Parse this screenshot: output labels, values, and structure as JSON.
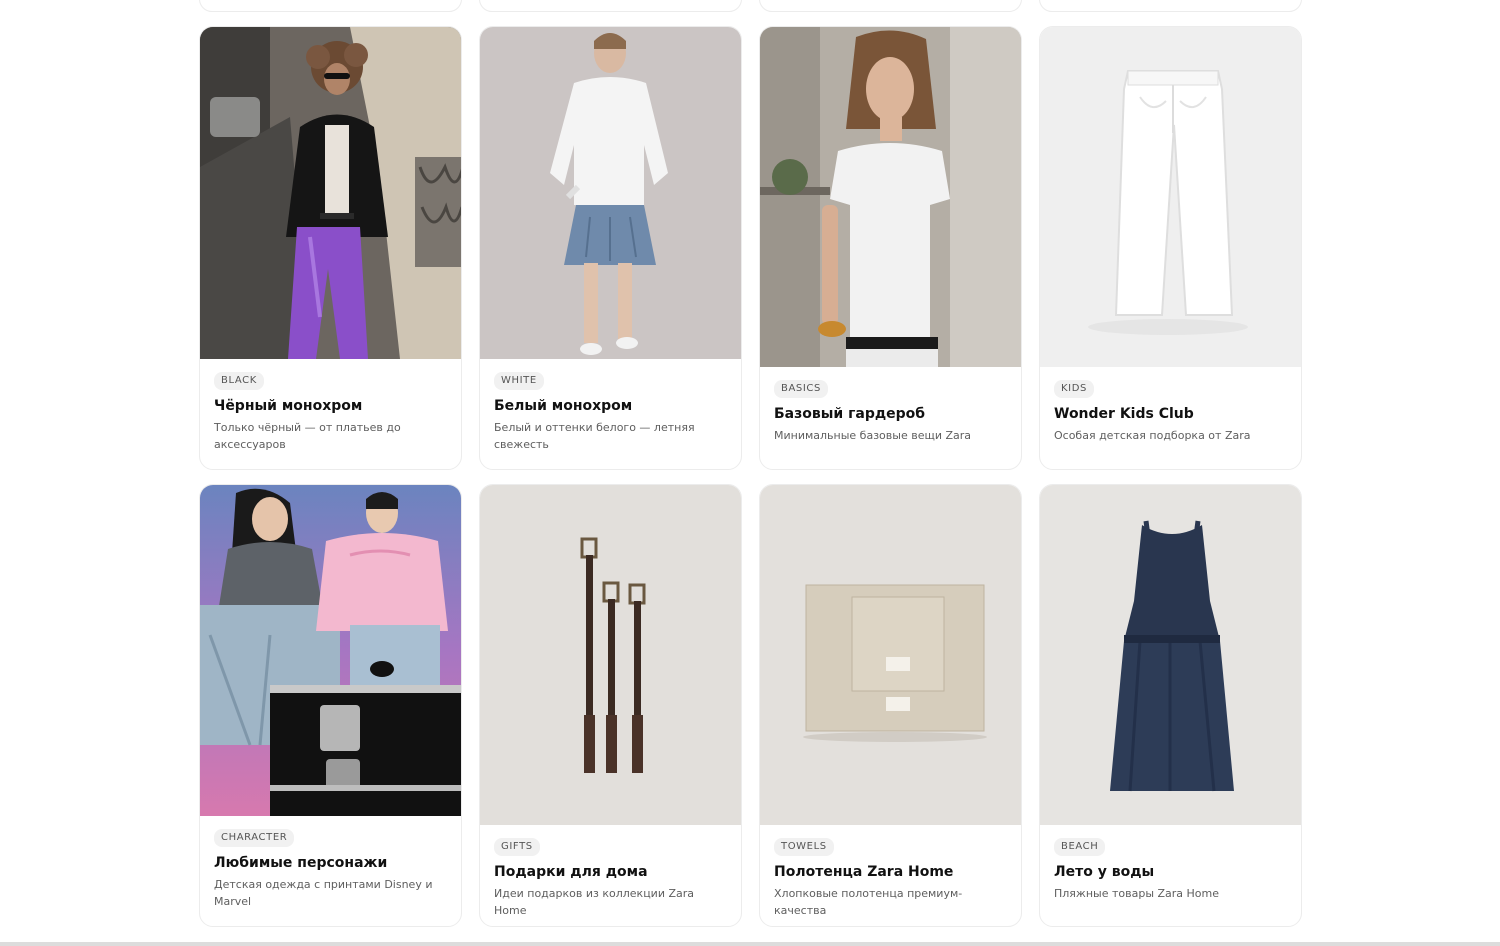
{
  "cards": [
    {
      "tag": "BLACK",
      "title": "Чёрный монохром",
      "desc": "Только чёрный — от платьев до аксессуаров",
      "image": "black-monochrome-photo"
    },
    {
      "tag": "WHITE",
      "title": "Белый монохром",
      "desc": "Белый и оттенки белого — летняя свежесть",
      "image": "white-monochrome-photo"
    },
    {
      "tag": "BASICS",
      "title": "Базовый гардероб",
      "desc": "Минимальные базовые вещи Zara",
      "image": "basics-photo"
    },
    {
      "tag": "KIDS",
      "title": "Wonder Kids Club",
      "desc": "Особая детская подборка от Zara",
      "image": "white-jeans-photo"
    },
    {
      "tag": "CHARACTER",
      "title": "Любимые персонажи",
      "desc": "Детская одежда с принтами Disney и Marvel",
      "image": "kids-characters-photo"
    },
    {
      "tag": "GIFTS",
      "title": "Подарки для дома",
      "desc": "Идеи подарков из коллекции Zara Home",
      "image": "leather-straps-photo"
    },
    {
      "tag": "TOWELS",
      "title": "Полотенца Zara Home",
      "desc": "Хлопковые полотенца премиум-качества",
      "image": "towels-photo"
    },
    {
      "tag": "BEACH",
      "title": "Лето у воды",
      "desc": "Пляжные товары Zara Home",
      "image": "navy-dress-photo"
    }
  ]
}
